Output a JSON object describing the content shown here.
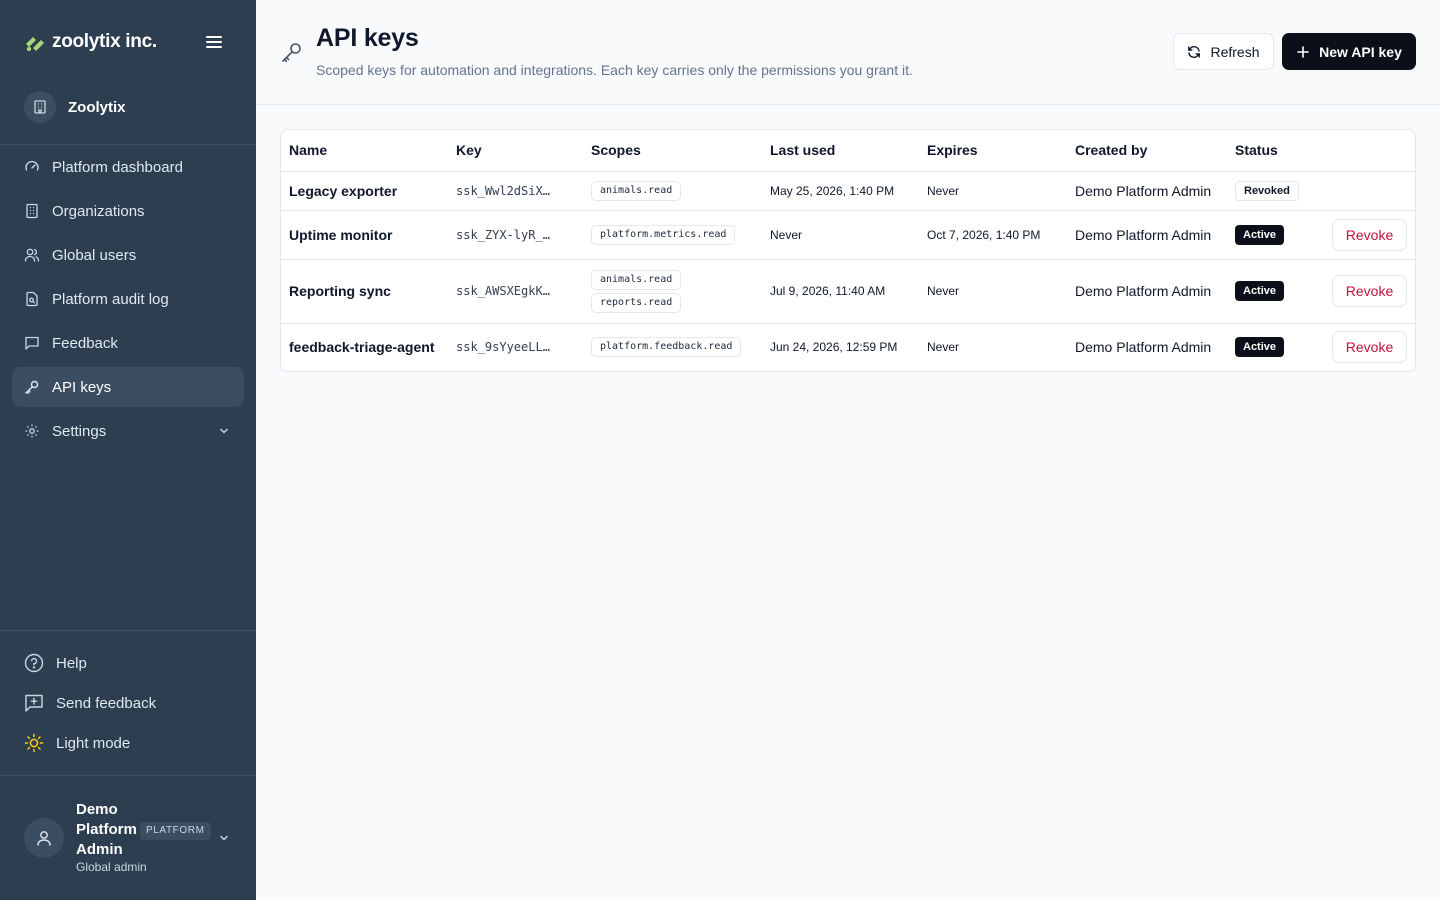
{
  "sidebar": {
    "brand_name": "zoolytix inc.",
    "org_name": "Zoolytix",
    "nav": [
      {
        "label": "Platform dashboard",
        "icon": "gauge-icon"
      },
      {
        "label": "Organizations",
        "icon": "building-icon"
      },
      {
        "label": "Global users",
        "icon": "users-icon"
      },
      {
        "label": "Platform audit log",
        "icon": "file-search-icon"
      },
      {
        "label": "Feedback",
        "icon": "message-square-icon"
      },
      {
        "label": "API keys",
        "icon": "key-icon",
        "active": true
      },
      {
        "label": "Settings",
        "icon": "gear-icon"
      }
    ],
    "bottom": {
      "help": "Help",
      "send_feedback": "Send feedback",
      "light_mode": "Light mode"
    },
    "user": {
      "name": "Demo Platform Admin",
      "badge": "PLATFORM",
      "role": "Global admin"
    }
  },
  "header": {
    "title": "API keys",
    "subtitle": "Scoped keys for automation and integrations. Each key carries only the permissions you grant it.",
    "refresh_label": "Refresh",
    "new_label": "New API key"
  },
  "table": {
    "columns": [
      "Name",
      "Key",
      "Scopes",
      "Last used",
      "Expires",
      "Created by",
      "Status"
    ],
    "rows": [
      {
        "name": "Legacy exporter",
        "key": "ssk_Wwl2dSiX…",
        "scopes": [
          "animals.read"
        ],
        "last_used": "May 25, 2026, 1:40 PM",
        "expires": "Never",
        "created_by": "Demo Platform Admin",
        "status": "Revoked",
        "action": ""
      },
      {
        "name": "Uptime monitor",
        "key": "ssk_ZYX-lyR_…",
        "scopes": [
          "platform.metrics.read"
        ],
        "last_used": "Never",
        "expires": "Oct 7, 2026, 1:40 PM",
        "created_by": "Demo Platform Admin",
        "status": "Active",
        "action": "Revoke"
      },
      {
        "name": "Reporting sync",
        "key": "ssk_AWSXEgkK…",
        "scopes": [
          "animals.read",
          "reports.read"
        ],
        "last_used": "Jul 9, 2026, 11:40 AM",
        "expires": "Never",
        "created_by": "Demo Platform Admin",
        "status": "Active",
        "action": "Revoke"
      },
      {
        "name": "feedback-triage-agent",
        "key": "ssk_9sYyeeLL…",
        "scopes": [
          "platform.feedback.read"
        ],
        "last_used": "Jun 24, 2026, 12:59 PM",
        "expires": "Never",
        "created_by": "Demo Platform Admin",
        "status": "Active",
        "action": "Revoke"
      }
    ]
  },
  "colors": {
    "sidebar_bg": "#2c3e50",
    "accent_dark": "#0b0f1a",
    "revoke_red": "#be123c",
    "brand_green": "#a3d977"
  }
}
